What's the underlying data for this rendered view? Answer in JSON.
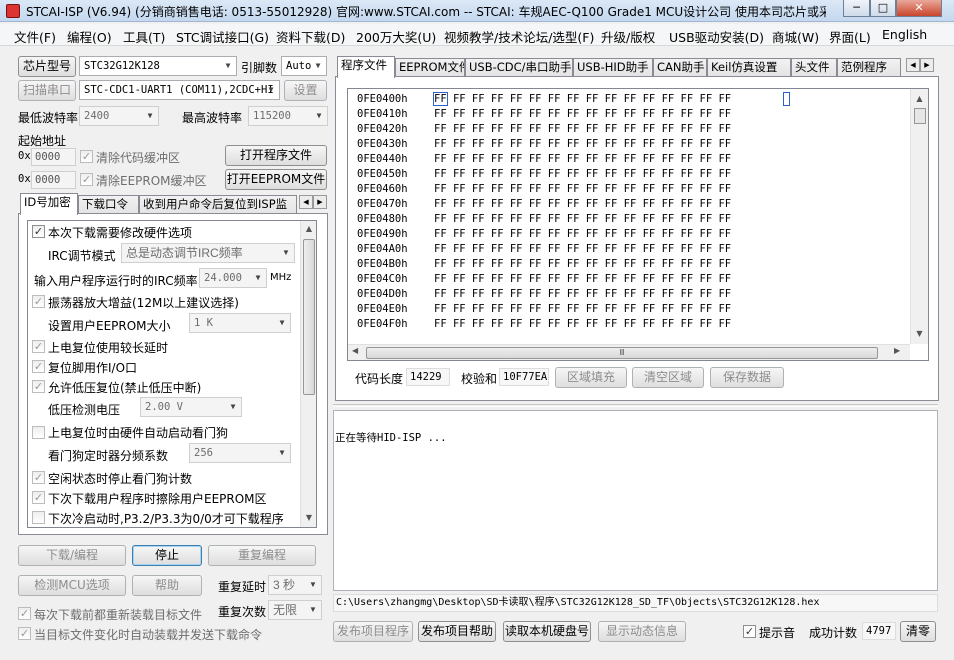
{
  "window": {
    "title": "STCAI-ISP (V6.94) (分销商销售电话: 0513-55012928) 官网:www.STCAI.com  -- STCAI: 车规AEC-Q100 Grade1 MCU设计公司 使用本司芯片或采...",
    "minimize": "─",
    "maximize": "□",
    "close": "✕"
  },
  "menu": [
    "文件(F)",
    "编程(O)",
    "工具(T)",
    "STC调试接口(G)",
    "资料下载(D)",
    "200万大奖(U)",
    "视频教学/技术论坛/选型(F)",
    "升级/版权",
    "USB驱动安装(D)",
    "商城(W)",
    "界面(L)",
    "English"
  ],
  "left": {
    "chip_label": "芯片型号",
    "chip_value": "STC32G12K128",
    "pins_label": "引脚数",
    "pins_value": "Auto",
    "scan_label": "扫描串口",
    "port_value": "STC-CDC1-UART1 (COM11),2CDC+HI",
    "settings_label": "设置",
    "min_baud_label": "最低波特率",
    "min_baud_value": "2400",
    "max_baud_label": "最高波特率",
    "max_baud_value": "115200",
    "start_addr_label": "起始地址",
    "addr1_prefix": "0x",
    "addr1": "0000",
    "clear_code_label": "清除代码缓冲区",
    "open_prog_label": "打开程序文件",
    "addr2_prefix": "0x",
    "addr2": "0000",
    "clear_eeprom_label": "清除EEPROM缓冲区",
    "open_eeprom_label": "打开EEPROM文件",
    "subtabs": [
      "ID号加密",
      "下载口令",
      "收到用户命令后复位到ISP监"
    ]
  },
  "options": {
    "opt1": "本次下载需要修改硬件选项",
    "irc_mode_label": "IRC调节模式",
    "irc_mode_value": "总是动态调节IRC频率",
    "freq_label": "输入用户程序运行时的IRC频率",
    "freq_value": "24.000",
    "freq_unit": "MHz",
    "opt_osc": "振荡器放大增益(12M以上建议选择)",
    "eeprom_size_label": "设置用户EEPROM大小",
    "eeprom_size_value": "1   K",
    "opt_delay": "上电复位使用较长延时",
    "opt_resetpin": "复位脚用作I/O口",
    "opt_lvr": "允许低压复位(禁止低压中断)",
    "lv_label": "低压检测电压",
    "lv_value": "2.00 V",
    "opt_wdt": "上电复位时由硬件自动启动看门狗",
    "wdt_div_label": "看门狗定时器分频系数",
    "wdt_div_value": "256",
    "opt_idle": "空闲状态时停止看门狗计数",
    "opt_erase": "下次下载用户程序时擦除用户EEPROM区",
    "opt_p32": "下次冷启动时,P3.2/P3.3为0/0才可下载程序"
  },
  "bottom_left": {
    "download": "下载/编程",
    "stop": "停止",
    "reprogram": "重复编程",
    "check_mcu": "检测MCU选项",
    "help": "帮助",
    "repeat_delay_label": "重复延时",
    "repeat_delay_value": "3 秒",
    "repeat_count_label": "重复次数",
    "repeat_count_value": "无限",
    "reload_label": "每次下载前都重新装载目标文件",
    "auto_send_label": "当目标文件变化时自动装载并发送下载命令"
  },
  "right_tabs": [
    "程序文件",
    "EEPROM文件",
    "USB-CDC/串口助手",
    "USB-HID助手",
    "CAN助手",
    "Keil仿真设置",
    "头文件",
    "范例程序"
  ],
  "hex": {
    "rows": [
      {
        "addr": "0FE0400h",
        "bytes": "FF FF FF FF FF FF FF FF FF FF FF FF FF FF FF FF"
      },
      {
        "addr": "0FE0410h",
        "bytes": "FF FF FF FF FF FF FF FF FF FF FF FF FF FF FF FF"
      },
      {
        "addr": "0FE0420h",
        "bytes": "FF FF FF FF FF FF FF FF FF FF FF FF FF FF FF FF"
      },
      {
        "addr": "0FE0430h",
        "bytes": "FF FF FF FF FF FF FF FF FF FF FF FF FF FF FF FF"
      },
      {
        "addr": "0FE0440h",
        "bytes": "FF FF FF FF FF FF FF FF FF FF FF FF FF FF FF FF"
      },
      {
        "addr": "0FE0450h",
        "bytes": "FF FF FF FF FF FF FF FF FF FF FF FF FF FF FF FF"
      },
      {
        "addr": "0FE0460h",
        "bytes": "FF FF FF FF FF FF FF FF FF FF FF FF FF FF FF FF"
      },
      {
        "addr": "0FE0470h",
        "bytes": "FF FF FF FF FF FF FF FF FF FF FF FF FF FF FF FF"
      },
      {
        "addr": "0FE0480h",
        "bytes": "FF FF FF FF FF FF FF FF FF FF FF FF FF FF FF FF"
      },
      {
        "addr": "0FE0490h",
        "bytes": "FF FF FF FF FF FF FF FF FF FF FF FF FF FF FF FF"
      },
      {
        "addr": "0FE04A0h",
        "bytes": "FF FF FF FF FF FF FF FF FF FF FF FF FF FF FF FF"
      },
      {
        "addr": "0FE04B0h",
        "bytes": "FF FF FF FF FF FF FF FF FF FF FF FF FF FF FF FF"
      },
      {
        "addr": "0FE04C0h",
        "bytes": "FF FF FF FF FF FF FF FF FF FF FF FF FF FF FF FF"
      },
      {
        "addr": "0FE04D0h",
        "bytes": "FF FF FF FF FF FF FF FF FF FF FF FF FF FF FF FF"
      },
      {
        "addr": "0FE04E0h",
        "bytes": "FF FF FF FF FF FF FF FF FF FF FF FF FF FF FF FF"
      },
      {
        "addr": "0FE04F0h",
        "bytes": "FF FF FF FF FF FF FF FF FF FF FF FF FF FF FF FF"
      }
    ],
    "hscroll_grip": "Ⅲ"
  },
  "code_info": {
    "length_label": "代码长度",
    "length_value": "14229",
    "checksum_label": "校验和",
    "checksum_value": "10F77EA",
    "fill_label": "区域填充",
    "clear_label": "清空区域",
    "save_label": "保存数据"
  },
  "log": {
    "text": "正在等待HID-ISP ..."
  },
  "filepath": "C:\\Users\\zhangmg\\Desktop\\SD卡读取\\程序\\STC32G12K128_SD_TF\\Objects\\STC32G12K128.hex",
  "bottom_right": {
    "publish_prog": "发布项目程序",
    "publish_help": "发布项目帮助",
    "read_disk": "读取本机硬盘号",
    "show_dynamic": "显示动态信息",
    "beep_label": "提示音",
    "success_label": "成功计数",
    "success_value": "4797",
    "clear_label": "清零"
  }
}
